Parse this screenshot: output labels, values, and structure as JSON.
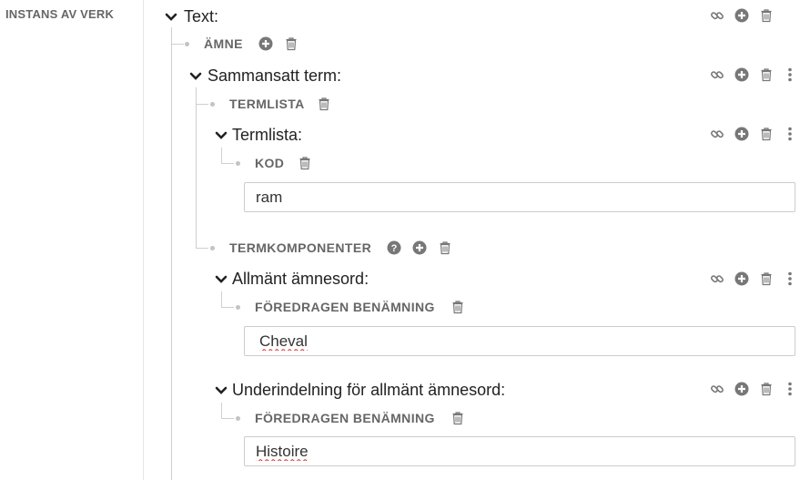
{
  "sidebar": {
    "label": "INSTANS AV VERK"
  },
  "tree": {
    "text_title": "Text:",
    "amne_label": "ÄMNE",
    "sammansatt_title": "Sammansatt term:",
    "termlista_label": "TERMLISTA",
    "termlista_title": "Termlista:",
    "kod_label": "KOD",
    "kod_value": "ram",
    "termkomponenter_label": "TERMKOMPONENTER",
    "allmant_title": "Allmänt ämnesord:",
    "pref_label_1": "FÖREDRAGEN BENÄMNING",
    "pref_value_1": "Cheval",
    "underindelning_title": "Underindelning för allmänt ämnesord:",
    "pref_label_2": "FÖREDRAGEN BENÄMNING",
    "pref_value_2": "Histoire"
  },
  "icons": {
    "link": "link-icon",
    "add": "add-circle-icon",
    "delete": "trash-icon",
    "more": "more-vertical-icon",
    "help": "help-circle-icon",
    "chevron": "chevron-down-icon"
  },
  "colors": {
    "icon": "#777777",
    "tree_line": "#cfcfcf",
    "text": "#222222",
    "label": "#666666"
  }
}
